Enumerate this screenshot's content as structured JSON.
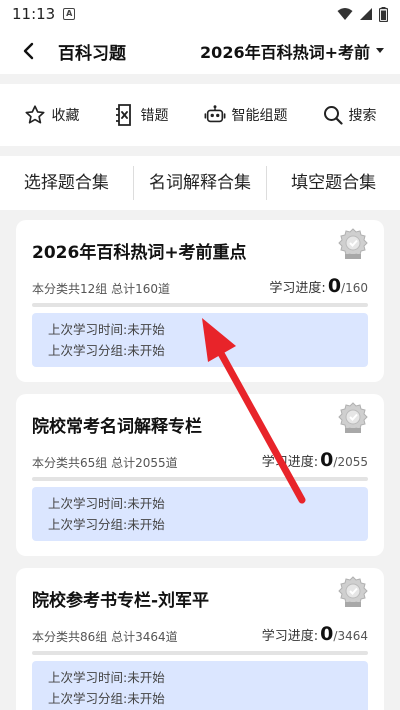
{
  "status": {
    "time": "11:13",
    "notif_glyph": "A"
  },
  "header": {
    "title": "百科习题",
    "subject": "2026年百科热词+考前"
  },
  "toolbar": [
    {
      "label": "收藏",
      "icon": "star-icon"
    },
    {
      "label": "错题",
      "icon": "wrong-question-icon"
    },
    {
      "label": "智能组题",
      "icon": "robot-icon"
    },
    {
      "label": "搜索",
      "icon": "search-icon"
    }
  ],
  "categories": [
    "选择题合集",
    "名词解释合集",
    "填空题合集"
  ],
  "cards": [
    {
      "title": "2026年百科热词+考前重点",
      "meta": "本分类共12组 总计160道",
      "progress_label": "学习进度:",
      "done": "0",
      "total": "/160",
      "progress_fraction": 0,
      "last_time": "上次学习时间:未开始",
      "last_group": "上次学习分组:未开始"
    },
    {
      "title": "院校常考名词解释专栏",
      "meta": "本分类共65组 总计2055道",
      "progress_label": "学习进度:",
      "done": "0",
      "total": "/2055",
      "progress_fraction": 0,
      "last_time": "上次学习时间:未开始",
      "last_group": "上次学习分组:未开始"
    },
    {
      "title": "院校参考书专栏-刘军平",
      "meta": "本分类共86组 总计3464道",
      "progress_label": "学习进度:",
      "done": "0",
      "total": "/3464",
      "progress_fraction": 0,
      "last_time": "上次学习时间:未开始",
      "last_group": "上次学习分组:未开始"
    }
  ],
  "colors": {
    "accent": "#4a7ef7",
    "info_bg": "#dbe6ff",
    "annotation_arrow": "#e8242a"
  }
}
